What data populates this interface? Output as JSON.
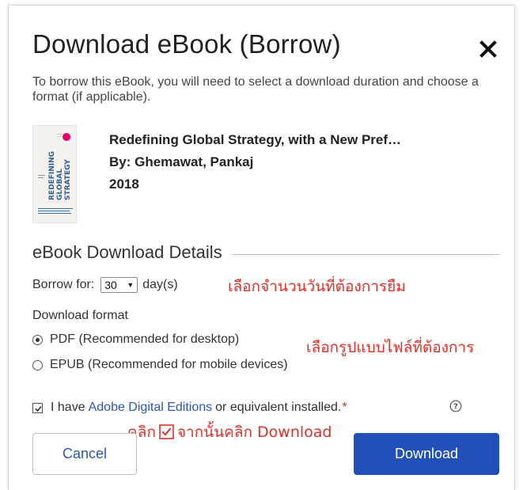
{
  "dialog": {
    "title": "Download eBook (Borrow)",
    "intro": "To borrow this eBook, you will need to select a download duration and choose a format (if applicable)."
  },
  "book": {
    "title": "Redefining Global Strategy, with a New Pref…",
    "author": "By: Ghemawat, Pankaj",
    "year": "2018",
    "cover_text": "REDEFINING GLOBAL STRATEGY"
  },
  "details": {
    "heading": "eBook Download Details",
    "borrow_label": "Borrow for:",
    "borrow_value": "30",
    "borrow_unit": "day(s)",
    "format_label": "Download format",
    "formats": [
      {
        "label": "PDF (Recommended for desktop)",
        "selected": true
      },
      {
        "label": "EPUB (Recommended for mobile devices)",
        "selected": false
      }
    ],
    "agree_prefix": "I have",
    "agree_link": "Adobe Digital Editions",
    "agree_suffix": "or equivalent installed.",
    "required_mark": "*",
    "agree_checked": true
  },
  "annotations": {
    "borrow_note": "เลือกจำนวนวันที่ต้องการยืม",
    "format_note": "เลือกรูปแบบไฟล์ที่ต้องการ",
    "click_note_prefix": "คลิก",
    "click_note_suffix": "จากนั้นคลิก Download"
  },
  "buttons": {
    "cancel": "Cancel",
    "download": "Download"
  },
  "icons": {
    "close": "close-icon",
    "help": "help-icon",
    "dropdown": "chevron-down-icon"
  },
  "colors": {
    "accent": "#2151b8",
    "link": "#2b56b4",
    "annotation": "#e0302a"
  }
}
